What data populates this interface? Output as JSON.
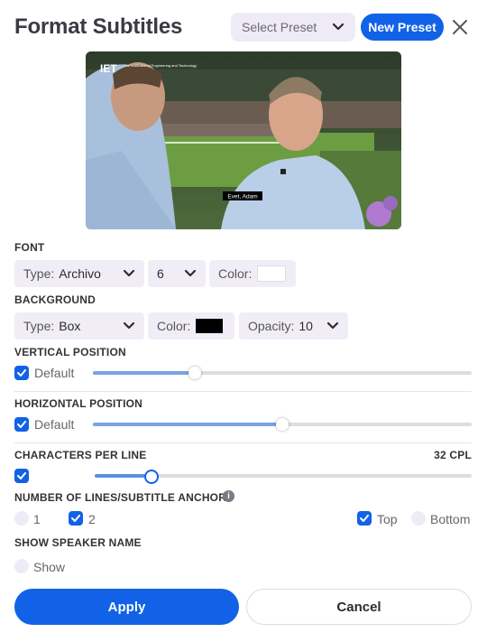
{
  "header": {
    "title": "Format Subtitles",
    "preset_placeholder": "Select Preset",
    "new_preset_label": "New Preset"
  },
  "preview": {
    "logo_text": "IET",
    "logo_sub": "The Institution of Engineering and Technology",
    "caption": "Evet, Adam"
  },
  "font": {
    "label": "FONT",
    "type_label": "Type:",
    "type_value": "Archivo",
    "size_value": "6",
    "color_label": "Color:",
    "color_value": "#ffffff"
  },
  "background": {
    "label": "BACKGROUND",
    "type_label": "Type:",
    "type_value": "Box",
    "color_label": "Color:",
    "color_value": "#000000",
    "opacity_label": "Opacity:",
    "opacity_value": "10"
  },
  "vertical_position": {
    "label": "VERTICAL POSITION",
    "default_label": "Default",
    "default_checked": true,
    "level": 0.27
  },
  "horizontal_position": {
    "label": "HORIZONTAL POSITION",
    "default_label": "Default",
    "default_checked": true,
    "level": 0.5
  },
  "chars_per_line": {
    "label": "CHARACTERS PER LINE",
    "value_text": "32 CPL",
    "checked": true,
    "level": 0.15
  },
  "lines": {
    "label": "NUMBER OF LINES/SUBTITLE ANCHOR",
    "options": [
      {
        "label": "1",
        "checked": false
      },
      {
        "label": "2",
        "checked": true
      }
    ],
    "anchors": [
      {
        "label": "Top",
        "checked": true
      },
      {
        "label": "Bottom",
        "checked": false
      }
    ]
  },
  "speaker": {
    "label": "SHOW SPEAKER NAME",
    "show_label": "Show",
    "checked": false
  },
  "actions": {
    "apply_label": "Apply",
    "cancel_label": "Cancel"
  },
  "colors": {
    "accent": "#1162e6",
    "dropdown_bg": "#f1edf7"
  }
}
